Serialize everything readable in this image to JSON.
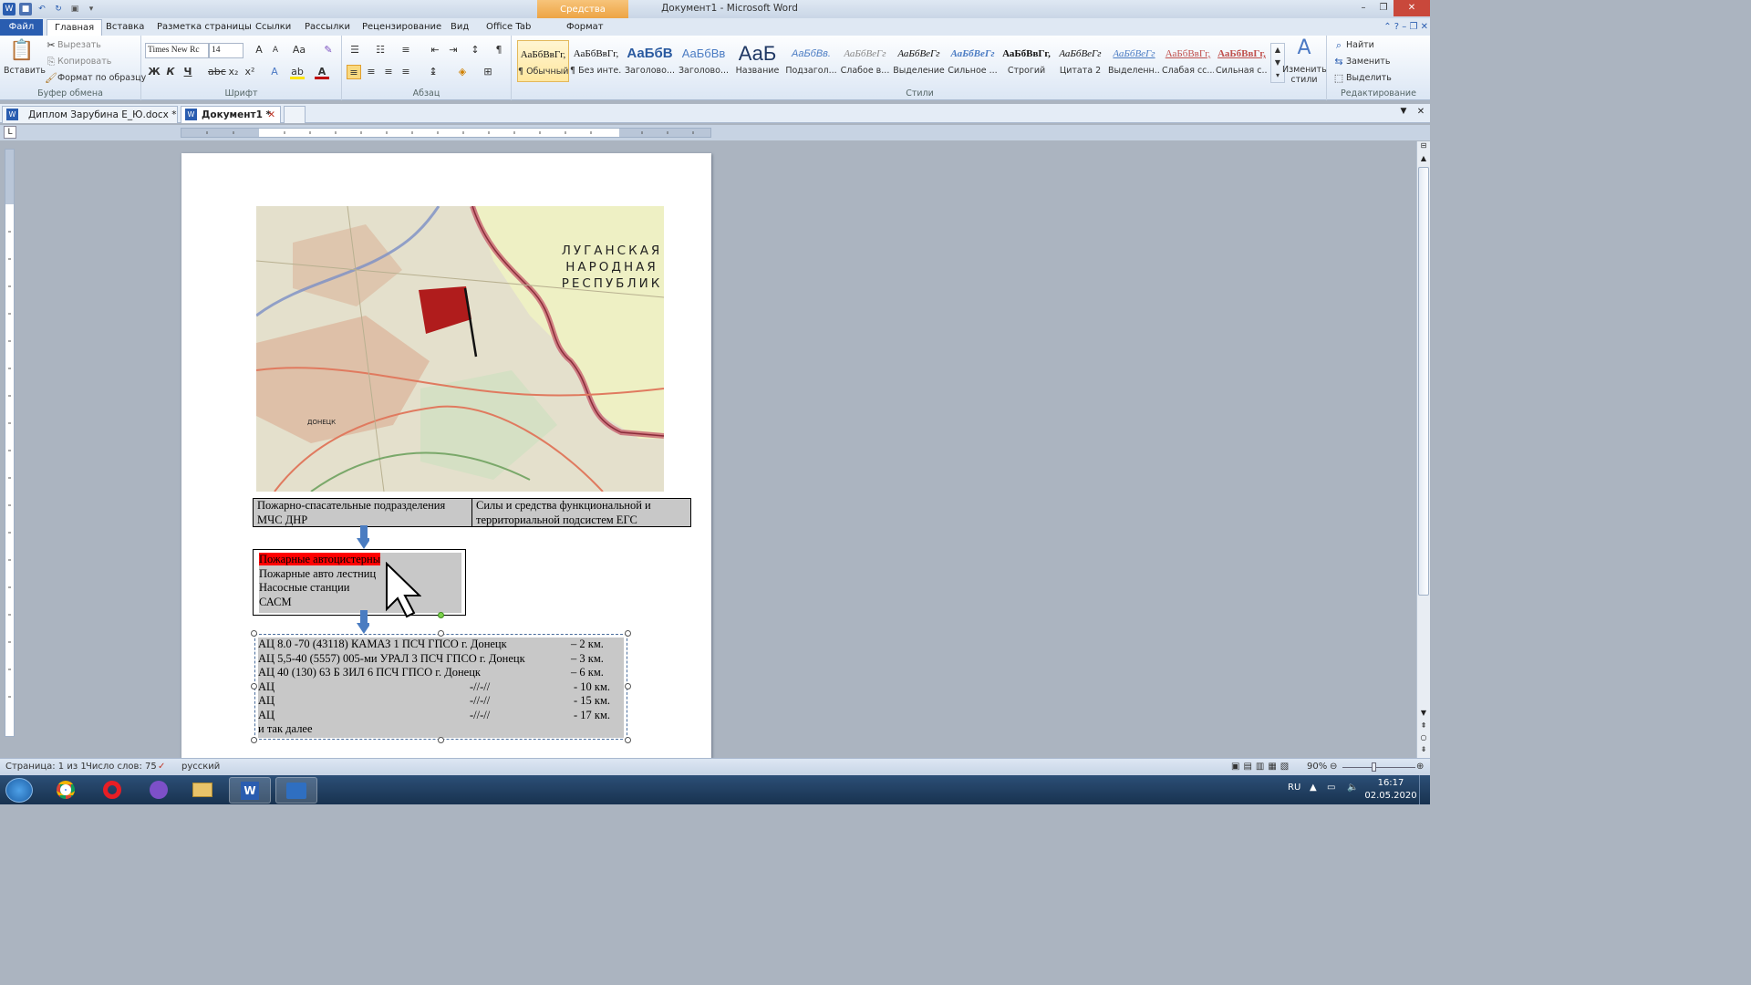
{
  "window": {
    "title": "Документ1 - Microsoft Word",
    "contextual_tab": "Средства рисования"
  },
  "ribbon_tabs": [
    "Файл",
    "Главная",
    "Вставка",
    "Разметка страницы",
    "Ссылки",
    "Рассылки",
    "Рецензирование",
    "Вид",
    "Office Tab",
    "Формат"
  ],
  "clipboard": {
    "paste": "Вставить",
    "cut": "Вырезать",
    "copy": "Копировать",
    "format_painter": "Формат по образцу",
    "group_label": "Буфер обмена"
  },
  "font": {
    "name": "Times New Rc",
    "size": "14",
    "group_label": "Шрифт"
  },
  "paragraph": {
    "group_label": "Абзац"
  },
  "styles": {
    "group_label": "Стили",
    "items": [
      {
        "sample": "АаБбВвГг,",
        "name": "¶ Обычный"
      },
      {
        "sample": "АаБбВвГг,",
        "name": "¶ Без инте..."
      },
      {
        "sample": "АаБбВ",
        "name": "Заголово..."
      },
      {
        "sample": "АаБбВв",
        "name": "Заголово..."
      },
      {
        "sample": "АаБ",
        "name": "Название"
      },
      {
        "sample": "АаБбВв.",
        "name": "Подзагол..."
      },
      {
        "sample": "АаБбВеГг",
        "name": "Слабое в..."
      },
      {
        "sample": "АаБбВеГг",
        "name": "Выделение"
      },
      {
        "sample": "АаБбВеГг",
        "name": "Сильное ..."
      },
      {
        "sample": "АаБбВвГг,",
        "name": "Строгий"
      },
      {
        "sample": "АаБбВеГг",
        "name": "Цитата 2"
      },
      {
        "sample": "АаБбВеГг",
        "name": "Выделенн..."
      },
      {
        "sample": "АаБбВвГг,",
        "name": "Слабая сс..."
      },
      {
        "sample": "АаБбВвГг,",
        "name": "Сильная с..."
      }
    ],
    "change_styles": "Изменить стили"
  },
  "editing": {
    "find": "Найти",
    "replace": "Заменить",
    "select": "Выделить",
    "group_label": "Редактирование"
  },
  "doc_tabs": [
    "Диплом Зарубина Е_Ю.docx *",
    "Документ1 *"
  ],
  "map": {
    "region_label": [
      "ЛУГАНСКАЯ",
      "НАРОДНАЯ",
      "РЕСПУБЛИК"
    ],
    "city_label": "ДОНЕЦК"
  },
  "document": {
    "top_row": [
      "Пожарно-спасательные подразделения МЧС ДНР",
      "Силы и средства функциональной и территориальной подсистем ЕГС"
    ],
    "equipment": {
      "highlighted": "Пожарные автоцистерны",
      "items": [
        "Пожарные авто лестниц",
        "Насосные станции",
        "САСМ"
      ]
    },
    "units": [
      {
        "name": "АЦ 8.0 -70 (43118) КАМАЗ 1 ПСЧ ГПСО г. Донецк",
        "mid": "",
        "dist": "– 2 км."
      },
      {
        "name": "АЦ 5,5-40 (5557) 005-ми УРАЛ 3 ПСЧ ГПСО г. Донецк",
        "mid": "",
        "dist": "– 3 км."
      },
      {
        "name": "АЦ 40 (130) 63 Б ЗИЛ 6 ПСЧ ГПСО г.  Донецк",
        "mid": "",
        "dist": "– 6 км."
      },
      {
        "name": "АЦ",
        "mid": "-//-//",
        "dist": "- 10 км."
      },
      {
        "name": "АЦ",
        "mid": "-//-//",
        "dist": "- 15 км."
      },
      {
        "name": "АЦ",
        "mid": "-//-//",
        "dist": "- 17 км."
      }
    ],
    "footer_line": "и так далее"
  },
  "status": {
    "page": "Страница: 1 из 1",
    "words": "Число слов: 75",
    "language": "русский",
    "zoom": "90%"
  },
  "taskbar": {
    "lang": "RU",
    "time": "16:17",
    "date": "02.05.2020"
  },
  "colors": {
    "highlight_red": "#ff0000",
    "box_gray": "#c8c8c8",
    "arrow_blue": "#4a7cc1",
    "flag_red": "#b01c1c"
  }
}
